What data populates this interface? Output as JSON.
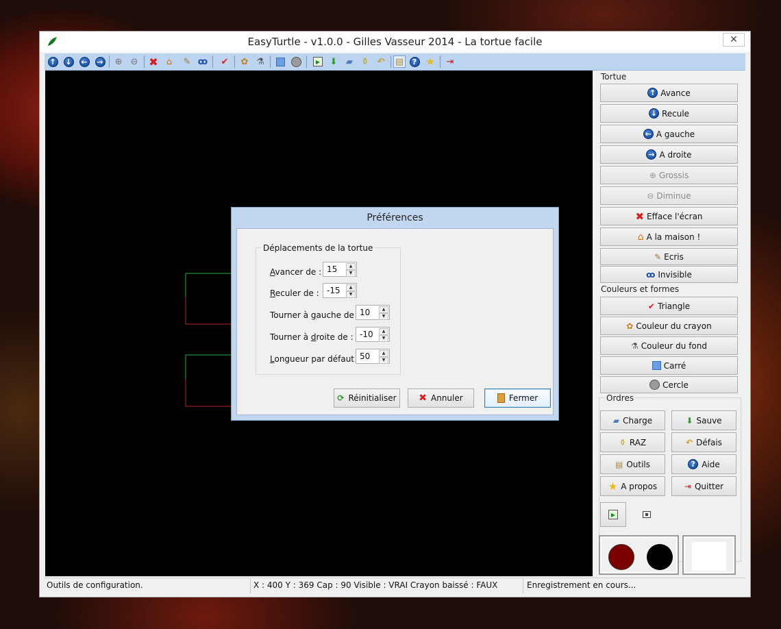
{
  "window": {
    "title": "EasyTurtle - v1.0.0 - Gilles Vasseur 2014 - La tortue facile",
    "close_label": "✕"
  },
  "toolbar": {
    "icons": [
      "arrow-up-icon",
      "arrow-down-icon",
      "arrow-left-icon",
      "arrow-right-icon",
      "zoom-in-icon",
      "zoom-out-icon",
      "clear-screen-icon",
      "home-icon",
      "pen-icon",
      "binoculars-icon",
      "check-icon",
      "palette-icon",
      "paint-bucket-icon",
      "square-icon",
      "circle-icon",
      "run-icon",
      "save-icon",
      "open-folder-icon",
      "broom-icon",
      "undo-icon",
      "tools-icon",
      "help-icon",
      "star-icon",
      "exit-icon"
    ]
  },
  "right_panel": {
    "tortue_label": "Tortue",
    "tortue_buttons": [
      {
        "label": "Avance",
        "icon": "arrow-up-icon",
        "enabled": true
      },
      {
        "label": "Recule",
        "icon": "arrow-down-icon",
        "enabled": true
      },
      {
        "label": "A gauche",
        "icon": "arrow-left-icon",
        "enabled": true
      },
      {
        "label": "A droite",
        "icon": "arrow-right-icon",
        "enabled": true
      },
      {
        "label": "Grossis",
        "icon": "zoom-in-icon",
        "enabled": false
      },
      {
        "label": "Diminue",
        "icon": "zoom-out-icon",
        "enabled": false
      },
      {
        "label": "Efface l'écran",
        "icon": "clear-screen-icon",
        "enabled": true
      },
      {
        "label": "A la maison !",
        "icon": "home-icon",
        "enabled": true
      },
      {
        "label": "Ecris",
        "icon": "pen-icon",
        "enabled": true
      },
      {
        "label": "Invisible",
        "icon": "binoculars-icon",
        "enabled": true
      }
    ],
    "couleurs_label": "Couleurs et formes",
    "couleurs_buttons": [
      {
        "label": "Triangle",
        "icon": "check-icon"
      },
      {
        "label": "Couleur du crayon",
        "icon": "palette-icon"
      },
      {
        "label": "Couleur du fond",
        "icon": "paint-bucket-icon"
      },
      {
        "label": "Carré",
        "icon": "square-icon"
      },
      {
        "label": "Cercle",
        "icon": "circle-icon"
      }
    ],
    "ordres_label": "Ordres",
    "ordres_buttons": [
      {
        "label": "Charge",
        "icon": "open-folder-icon"
      },
      {
        "label": "Sauve",
        "icon": "save-icon"
      },
      {
        "label": "RAZ",
        "icon": "broom-icon"
      },
      {
        "label": "Défais",
        "icon": "undo-icon"
      },
      {
        "label": "Outils",
        "icon": "tools-icon"
      },
      {
        "label": "Aide",
        "icon": "help-icon"
      },
      {
        "label": "A propos",
        "icon": "star-icon"
      },
      {
        "label": "Quitter",
        "icon": "exit-icon"
      }
    ],
    "colors": {
      "pen": "#7a0000",
      "pen2": "#000000",
      "background": "#ffffff"
    }
  },
  "status": {
    "left": "Outils de configuration.",
    "middle": "X : 400 Y : 369 Cap : 90 Visible : VRAI Crayon baissé : FAUX",
    "right": "Enregistrement en cours..."
  },
  "dialog": {
    "title": "Préférences",
    "group_title": "Déplacements de la tortue",
    "fields": [
      {
        "label": "Avancer de :",
        "value": "15"
      },
      {
        "label": "Reculer de :",
        "value": "-15"
      },
      {
        "label": "Tourner à gauche de :",
        "value": "10"
      },
      {
        "label": "Tourner à droite de :",
        "value": "-10"
      },
      {
        "label": "Longueur par défaut :",
        "value": "50"
      }
    ],
    "buttons": {
      "reset": "Réinitialiser",
      "cancel": "Annuler",
      "close": "Fermer"
    }
  }
}
